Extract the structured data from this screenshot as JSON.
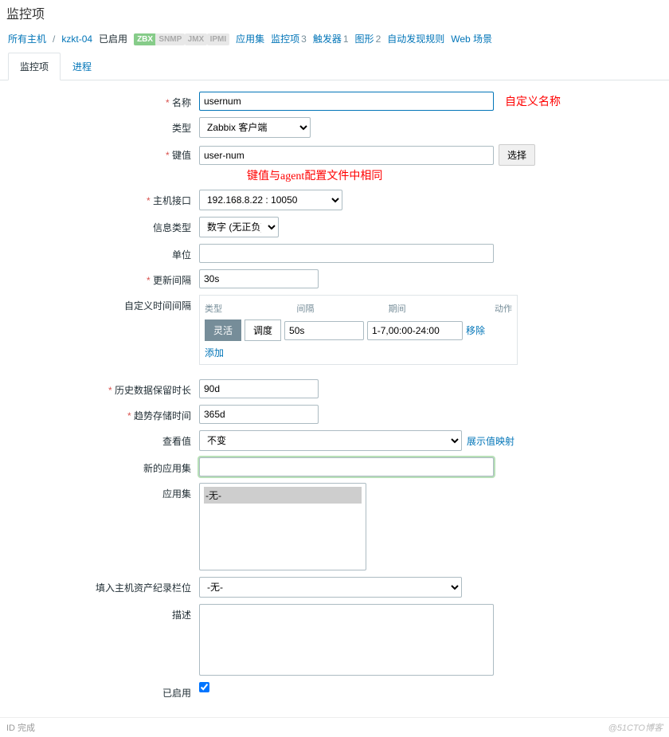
{
  "page": {
    "title": "监控项"
  },
  "breadcrumb": {
    "all_hosts": "所有主机",
    "host": "kzkt-04",
    "enabled": "已启用",
    "badges": {
      "zbx": "ZBX",
      "snmp": "SNMP",
      "jmx": "JMX",
      "ipmi": "IPMI"
    },
    "links": {
      "applications": "应用集",
      "items": "监控项",
      "items_count": "3",
      "triggers": "触发器",
      "triggers_count": "1",
      "graphs": "图形",
      "graphs_count": "2",
      "discovery": "自动发现规则",
      "web": "Web 场景"
    }
  },
  "tabs": {
    "item": "监控项",
    "process": "进程"
  },
  "form": {
    "name_label": "名称",
    "name_value": "usernum",
    "name_annotation": "自定义名称",
    "type_label": "类型",
    "type_value": "Zabbix 客户端",
    "key_label": "键值",
    "key_value": "user-num",
    "key_annotation": "键值与agent配置文件中相同",
    "key_btn": "选择",
    "interface_label": "主机接口",
    "interface_value": "192.168.8.22 : 10050",
    "info_type_label": "信息类型",
    "info_type_value": "数字 (无正负)",
    "units_label": "单位",
    "units_value": "",
    "update_interval_label": "更新间隔",
    "update_interval_value": "30s",
    "custom_intervals_label": "自定义时间间隔",
    "intervals": {
      "col_type": "类型",
      "col_interval": "间隔",
      "col_period": "期间",
      "col_action": "动作",
      "flexible": "灵活",
      "scheduling": "调度",
      "interval_value": "50s",
      "period_value": "1-7,00:00-24:00",
      "remove": "移除",
      "add": "添加"
    },
    "history_label": "历史数据保留时长",
    "history_value": "90d",
    "trends_label": "趋势存储时间",
    "trends_value": "365d",
    "show_value_label": "查看值",
    "show_value_value": "不变",
    "show_value_link": "展示值映射",
    "new_app_label": "新的应用集",
    "new_app_value": "",
    "apps_label": "应用集",
    "apps_none": "-无-",
    "inventory_label": "填入主机资产纪录栏位",
    "inventory_value": "-无-",
    "description_label": "描述",
    "description_value": "",
    "enabled_label": "已启用",
    "enabled_value": true
  },
  "footer": {
    "left": "ID 完成",
    "watermark": "@51CTO博客"
  }
}
